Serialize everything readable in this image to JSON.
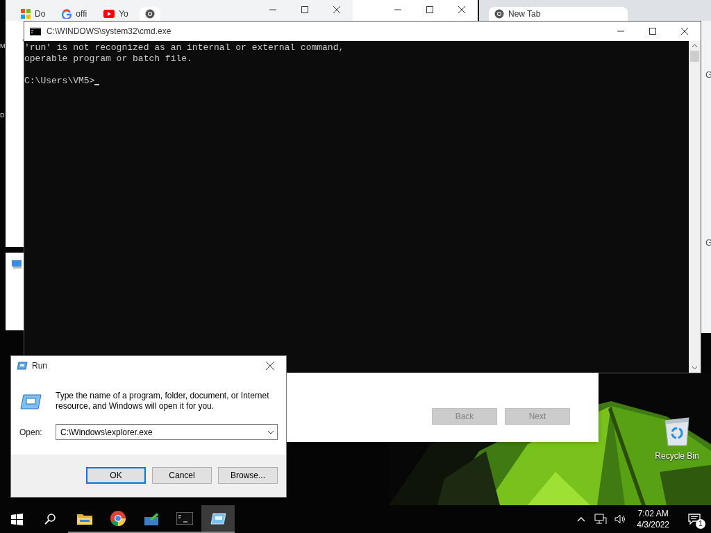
{
  "background_windows": {
    "left_edge_texts": [
      "M",
      "D"
    ],
    "browser_left": {
      "tabs": [
        {
          "kind": "squares",
          "label": "Do",
          "selected": false
        },
        {
          "kind": "g",
          "label": "offi",
          "selected": false
        },
        {
          "kind": "play",
          "label": "Yo",
          "selected": false
        },
        {
          "kind": "chrome",
          "selected": true
        }
      ]
    },
    "browser_right": {
      "tabs": [
        {
          "kind": "chrome",
          "label": "New Tab",
          "selected": true
        }
      ],
      "edge_texts": [
        "G",
        "G"
      ]
    }
  },
  "cmd": {
    "title": "C:\\WINDOWS\\system32\\cmd.exe",
    "output": [
      "'run' is not recognized as an internal or external command,",
      "operable program or batch file."
    ],
    "prompt": "C:\\Users\\VM5>"
  },
  "wizard": {
    "buttons": [
      {
        "label": "Back",
        "disabled": true
      },
      {
        "label": "Next",
        "disabled": true
      }
    ]
  },
  "run_dialog": {
    "title": "Run",
    "description": "Type the name of a program, folder, document, or Internet resource, and Windows will open it for you.",
    "open_label": "Open:",
    "value": "C:\\Windows\\explorer.exe",
    "buttons": [
      {
        "label": "OK",
        "default": true
      },
      {
        "label": "Cancel",
        "default": false
      },
      {
        "label": "Browse...",
        "default": false
      }
    ]
  },
  "desktop_icons": [
    {
      "kind": "recycle",
      "label": "Recycle Bin"
    }
  ],
  "taskbar": {
    "items": [
      {
        "kind": "start",
        "running": false,
        "selected": false
      },
      {
        "kind": "search",
        "running": false,
        "selected": false
      },
      {
        "kind": "folder",
        "running": true,
        "selected": false
      },
      {
        "kind": "browser",
        "running": true,
        "selected": false
      },
      {
        "kind": "app",
        "running": true,
        "selected": false
      },
      {
        "kind": "terminal",
        "running": true,
        "selected": false
      },
      {
        "kind": "run",
        "running": true,
        "selected": true
      }
    ],
    "tray": {
      "time": "7:02 AM",
      "date": "4/3/2022",
      "notifications": "1"
    }
  }
}
